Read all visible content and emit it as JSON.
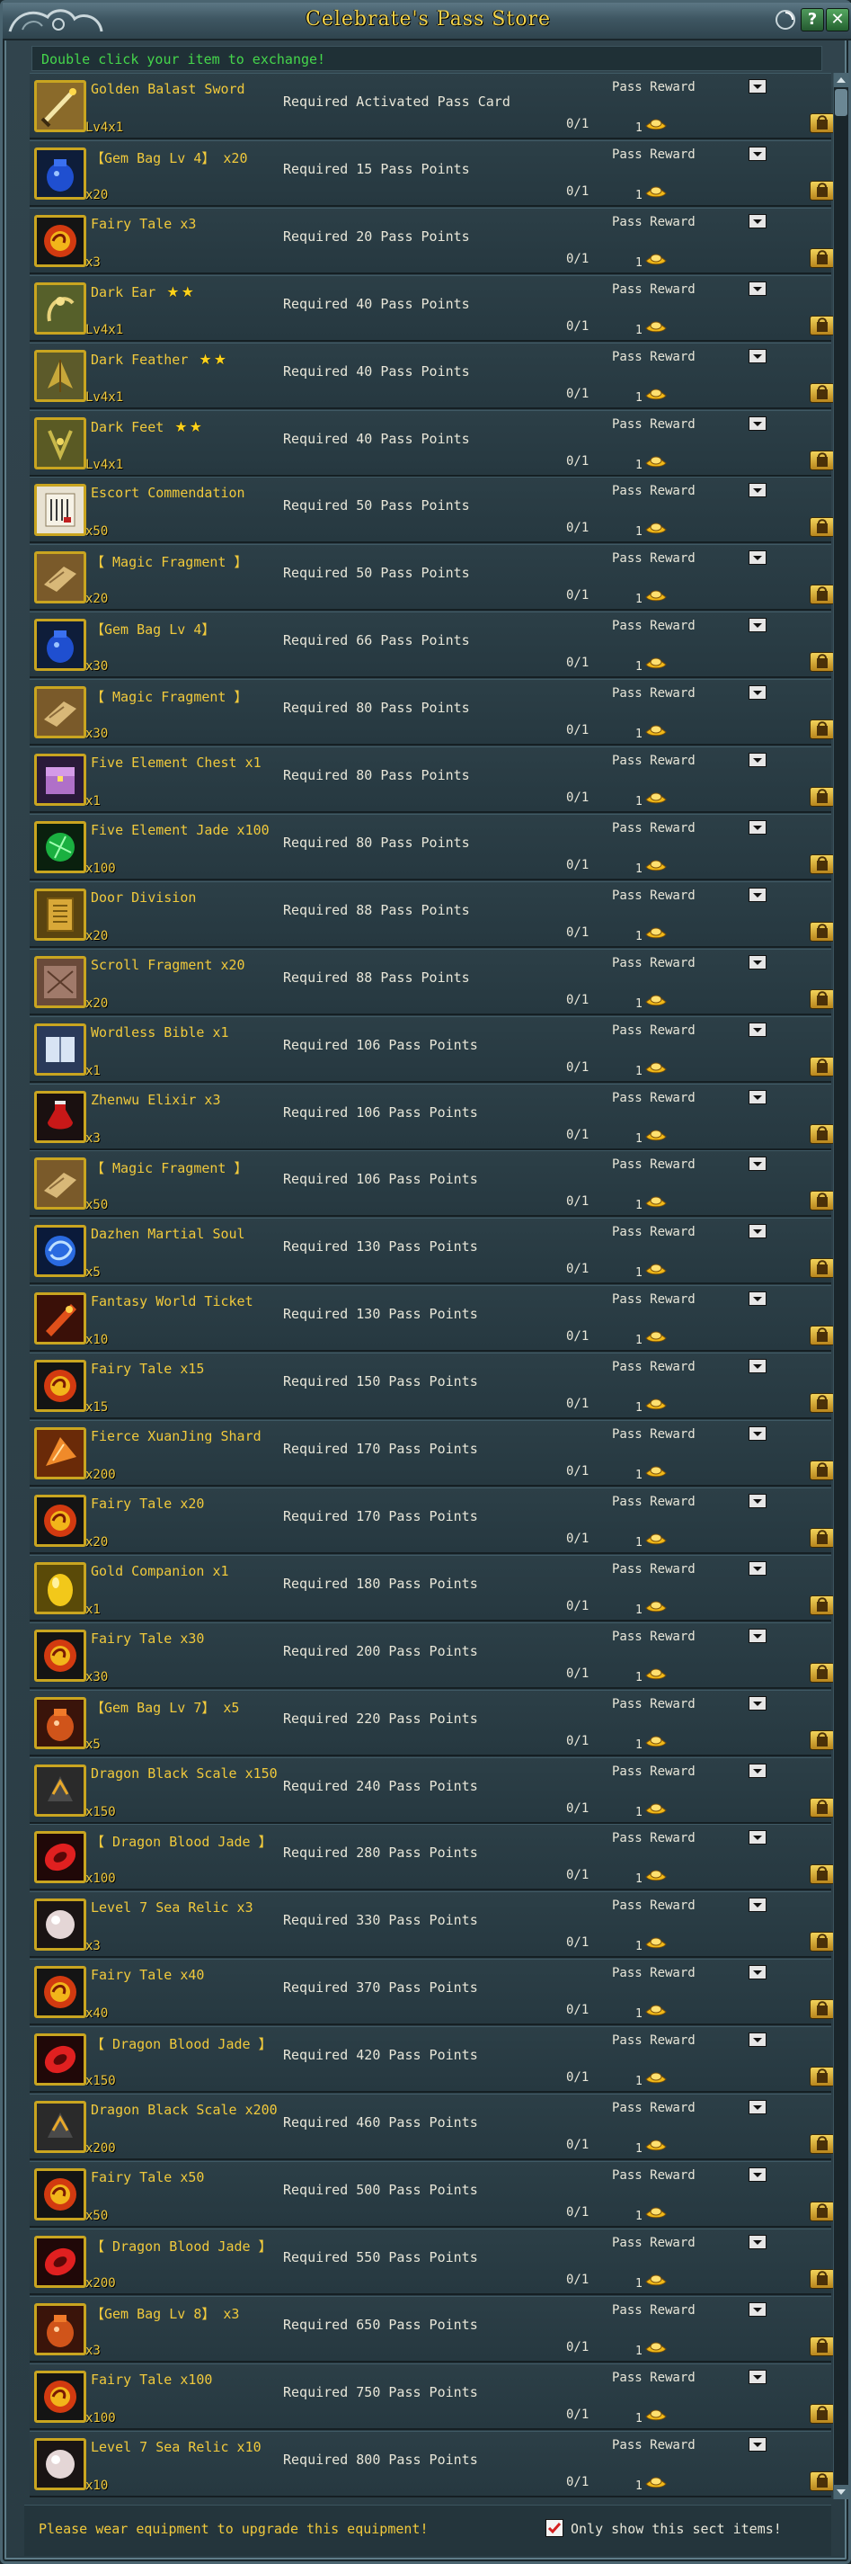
{
  "window": {
    "title": "Celebrate's Pass Store",
    "help_label": "?",
    "close_label": "✕"
  },
  "hint_text": "Double click your item to exchange!",
  "footer": {
    "note": "Please wear equipment to upgrade this equipment!",
    "filter_label": "Only show this sect items!",
    "filter_checked": true
  },
  "items": [
    {
      "name": "Golden Balast Sword",
      "qty": "Lv4x1",
      "requirement": "Required Activated Pass Card",
      "progress": "0/1",
      "reward_label": "Pass Reward",
      "reward_count": "1",
      "icon": "sword-icon"
    },
    {
      "name": "【Gem Bag Lv 4】 x20",
      "qty": "x20",
      "requirement": "Required 15 Pass Points",
      "progress": "0/1",
      "reward_label": "Pass Reward",
      "reward_count": "1",
      "icon": "gem-bag-icon"
    },
    {
      "name": "Fairy Tale x3",
      "qty": "x3",
      "requirement": "Required 20 Pass Points",
      "progress": "0/1",
      "reward_label": "Pass Reward",
      "reward_count": "1",
      "icon": "fairy-tale-icon"
    },
    {
      "name": "Dark Ear",
      "stars": "★★",
      "qty": "Lv4x1",
      "requirement": "Required 40 Pass Points",
      "progress": "0/1",
      "reward_label": "Pass Reward",
      "reward_count": "1",
      "icon": "dark-ear-icon"
    },
    {
      "name": "Dark Feather",
      "stars": "★★",
      "qty": "Lv4x1",
      "requirement": "Required 40 Pass Points",
      "progress": "0/1",
      "reward_label": "Pass Reward",
      "reward_count": "1",
      "icon": "dark-feather-icon"
    },
    {
      "name": "Dark Feet",
      "stars": "★★",
      "qty": "Lv4x1",
      "requirement": "Required 40 Pass Points",
      "progress": "0/1",
      "reward_label": "Pass Reward",
      "reward_count": "1",
      "icon": "dark-feet-icon"
    },
    {
      "name": "Escort Commendation",
      "qty": "x50",
      "requirement": "Required 50 Pass Points",
      "progress": "0/1",
      "reward_label": "Pass Reward",
      "reward_count": "1",
      "icon": "commendation-icon"
    },
    {
      "name": "【 Magic Fragment 】",
      "qty": "x20",
      "requirement": "Required 50 Pass Points",
      "progress": "0/1",
      "reward_label": "Pass Reward",
      "reward_count": "1",
      "icon": "magic-fragment-icon"
    },
    {
      "name": "【Gem Bag Lv 4】",
      "qty": "x30",
      "requirement": "Required 66 Pass Points",
      "progress": "0/1",
      "reward_label": "Pass Reward",
      "reward_count": "1",
      "icon": "gem-bag-icon"
    },
    {
      "name": "【 Magic Fragment 】",
      "qty": "x30",
      "requirement": "Required 80 Pass Points",
      "progress": "0/1",
      "reward_label": "Pass Reward",
      "reward_count": "1",
      "icon": "magic-fragment-icon"
    },
    {
      "name": "Five Element Chest x1",
      "qty": "x1",
      "requirement": "Required 80 Pass Points",
      "progress": "0/1",
      "reward_label": "Pass Reward",
      "reward_count": "1",
      "icon": "chest-icon"
    },
    {
      "name": "Five Element Jade x100",
      "qty": "x100",
      "requirement": "Required 80 Pass Points",
      "progress": "0/1",
      "reward_label": "Pass Reward",
      "reward_count": "1",
      "icon": "jade-icon"
    },
    {
      "name": "Door Division",
      "qty": "x20",
      "requirement": "Required 88 Pass Points",
      "progress": "0/1",
      "reward_label": "Pass Reward",
      "reward_count": "1",
      "icon": "door-division-icon"
    },
    {
      "name": "Scroll Fragment x20",
      "qty": "x20",
      "requirement": "Required 88 Pass Points",
      "progress": "0/1",
      "reward_label": "Pass Reward",
      "reward_count": "1",
      "icon": "scroll-fragment-icon"
    },
    {
      "name": "Wordless Bible x1",
      "qty": "x1",
      "requirement": "Required 106 Pass Points",
      "progress": "0/1",
      "reward_label": "Pass Reward",
      "reward_count": "1",
      "icon": "bible-icon"
    },
    {
      "name": "Zhenwu Elixir x3",
      "qty": "x3",
      "requirement": "Required 106 Pass Points",
      "progress": "0/1",
      "reward_label": "Pass Reward",
      "reward_count": "1",
      "icon": "elixir-icon"
    },
    {
      "name": "【 Magic Fragment 】",
      "qty": "x50",
      "requirement": "Required 106 Pass Points",
      "progress": "0/1",
      "reward_label": "Pass Reward",
      "reward_count": "1",
      "icon": "magic-fragment-icon"
    },
    {
      "name": "Dazhen Martial Soul",
      "qty": "x5",
      "requirement": "Required 130 Pass Points",
      "progress": "0/1",
      "reward_label": "Pass Reward",
      "reward_count": "1",
      "icon": "martial-soul-icon"
    },
    {
      "name": "Fantasy World Ticket",
      "qty": "x10",
      "requirement": "Required 130 Pass Points",
      "progress": "0/1",
      "reward_label": "Pass Reward",
      "reward_count": "1",
      "icon": "ticket-icon"
    },
    {
      "name": "Fairy Tale x15",
      "qty": "x15",
      "requirement": "Required 150 Pass Points",
      "progress": "0/1",
      "reward_label": "Pass Reward",
      "reward_count": "1",
      "icon": "fairy-tale-icon"
    },
    {
      "name": "Fierce XuanJing Shard",
      "qty": "x200",
      "requirement": "Required 170 Pass Points",
      "progress": "0/1",
      "reward_label": "Pass Reward",
      "reward_count": "1",
      "icon": "shard-icon"
    },
    {
      "name": "Fairy Tale x20",
      "qty": "x20",
      "requirement": "Required 170 Pass Points",
      "progress": "0/1",
      "reward_label": "Pass Reward",
      "reward_count": "1",
      "icon": "fairy-tale-icon"
    },
    {
      "name": "Gold Companion x1",
      "qty": "x1",
      "requirement": "Required 180 Pass Points",
      "progress": "0/1",
      "reward_label": "Pass Reward",
      "reward_count": "1",
      "icon": "gold-egg-icon"
    },
    {
      "name": "Fairy Tale x30",
      "qty": "x30",
      "requirement": "Required 200 Pass Points",
      "progress": "0/1",
      "reward_label": "Pass Reward",
      "reward_count": "1",
      "icon": "fairy-tale-icon"
    },
    {
      "name": "【Gem Bag Lv 7】 x5",
      "qty": "x5",
      "requirement": "Required 220 Pass Points",
      "progress": "0/1",
      "reward_label": "Pass Reward",
      "reward_count": "1",
      "icon": "red-gem-bag-icon"
    },
    {
      "name": "Dragon Black Scale x150",
      "qty": "x150",
      "requirement": "Required 240 Pass Points",
      "progress": "0/1",
      "reward_label": "Pass Reward",
      "reward_count": "1",
      "icon": "black-scale-icon"
    },
    {
      "name": "【 Dragon Blood Jade 】",
      "qty": "x100",
      "requirement": "Required 280 Pass Points",
      "progress": "0/1",
      "reward_label": "Pass Reward",
      "reward_count": "1",
      "icon": "blood-jade-icon"
    },
    {
      "name": "Level 7 Sea Relic x3",
      "qty": "x3",
      "requirement": "Required 330 Pass Points",
      "progress": "0/1",
      "reward_label": "Pass Reward",
      "reward_count": "1",
      "icon": "pearl-icon"
    },
    {
      "name": "Fairy Tale x40",
      "qty": "x40",
      "requirement": "Required 370 Pass Points",
      "progress": "0/1",
      "reward_label": "Pass Reward",
      "reward_count": "1",
      "icon": "fairy-tale-icon"
    },
    {
      "name": "【 Dragon Blood Jade 】",
      "qty": "x150",
      "requirement": "Required 420 Pass Points",
      "progress": "0/1",
      "reward_label": "Pass Reward",
      "reward_count": "1",
      "icon": "blood-jade-icon"
    },
    {
      "name": "Dragon Black Scale x200",
      "qty": "x200",
      "requirement": "Required 460 Pass Points",
      "progress": "0/1",
      "reward_label": "Pass Reward",
      "reward_count": "1",
      "icon": "black-scale-icon"
    },
    {
      "name": "Fairy Tale x50",
      "qty": "x50",
      "requirement": "Required 500 Pass Points",
      "progress": "0/1",
      "reward_label": "Pass Reward",
      "reward_count": "1",
      "icon": "fairy-tale-icon"
    },
    {
      "name": "【 Dragon Blood Jade 】",
      "qty": "x200",
      "requirement": "Required 550 Pass Points",
      "progress": "0/1",
      "reward_label": "Pass Reward",
      "reward_count": "1",
      "icon": "blood-jade-icon"
    },
    {
      "name": "【Gem Bag Lv 8】 x3",
      "qty": "x3",
      "requirement": "Required 650 Pass Points",
      "progress": "0/1",
      "reward_label": "Pass Reward",
      "reward_count": "1",
      "icon": "red-gem-bag-icon"
    },
    {
      "name": "Fairy Tale x100",
      "qty": "x100",
      "requirement": "Required 750 Pass Points",
      "progress": "0/1",
      "reward_label": "Pass Reward",
      "reward_count": "1",
      "icon": "fairy-tale-icon"
    },
    {
      "name": "Level 7 Sea Relic x10",
      "qty": "x10",
      "requirement": "Required 800 Pass Points",
      "progress": "0/1",
      "reward_label": "Pass Reward",
      "reward_count": "1",
      "icon": "pearl-icon"
    }
  ],
  "colors": {
    "item_name": "#f0c93c",
    "hint_text": "#45d64b",
    "icon_border": "#c9a520"
  }
}
